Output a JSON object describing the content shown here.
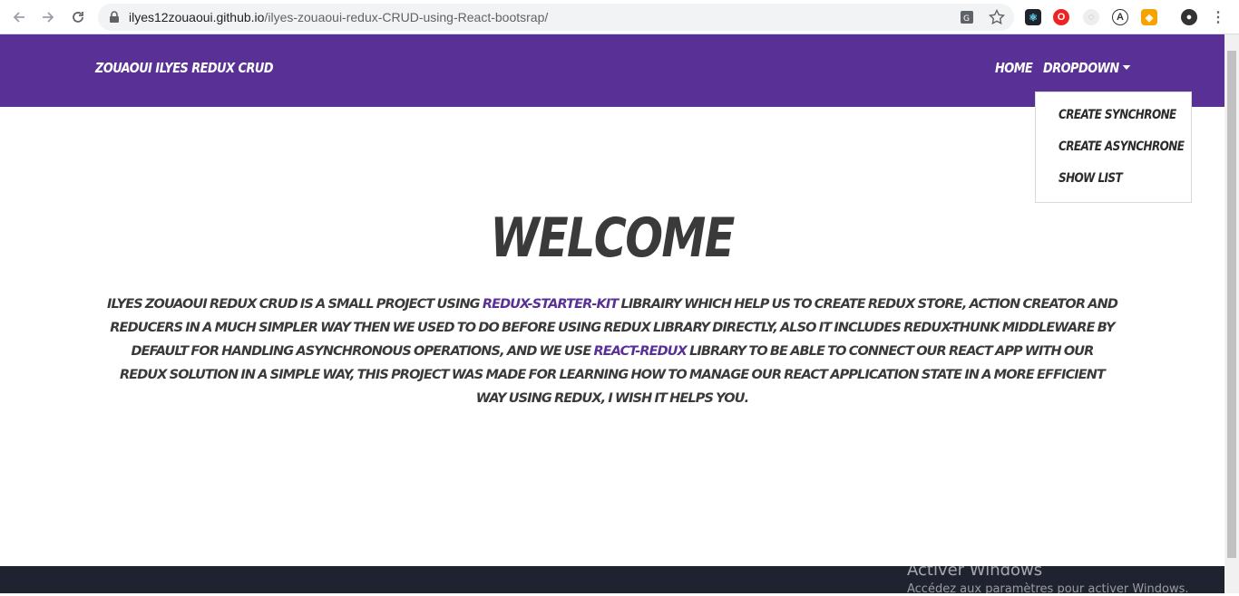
{
  "browser": {
    "url_host": "ilyes12zouaoui.github.io",
    "url_path": "/ilyes-zouaoui-redux-CRUD-using-React-bootsrap/"
  },
  "navbar": {
    "brand": "Zouaoui Ilyes Redux CRUD",
    "home": "Home",
    "dropdown": "Dropdown",
    "color": "#593196"
  },
  "dropdown_menu": {
    "items": [
      "Create Synchrone",
      "Create Asynchrone",
      "Show list"
    ]
  },
  "main": {
    "title": "Welcome",
    "para_1": "Ilyes Zouaoui Redux CRUD is a small project using ",
    "link_1": "redux-starter-kit",
    "para_2": " librairy which help us to create redux store, action creator and reducers in a much simpler way then we used to do before using redux library directly, also it includes redux-thunk middleware by default for handling asynchronous operations, and we use ",
    "link_2": "react-redux",
    "para_3": " library to be able to connect our react app with our redux solution in a simple way, this project was made for learning how to manage our react application state in a more efficient way using redux, I wish it helps you."
  },
  "os_watermark": {
    "title": "Activer Windows",
    "subtitle": "Accédez aux paramètres pour activer Windows."
  }
}
